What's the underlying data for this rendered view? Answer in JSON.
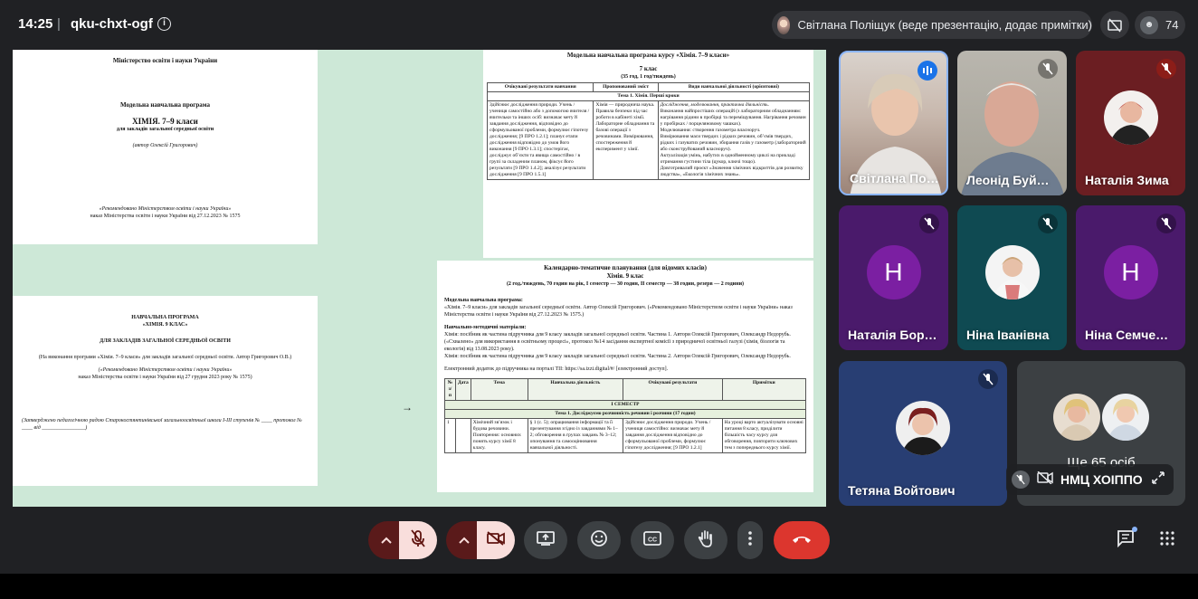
{
  "meeting": {
    "time": "14:25",
    "separator": "|",
    "code": "qku-chxt-ogf",
    "presenter_label": "Світлана Поліщук (веде презентацію, додає примітки)",
    "participants_count": "74"
  },
  "colors": {
    "background": "#202124",
    "accent_red": "#dc362e",
    "avatar_purple": "#7b1fa2",
    "slide_bg": "#cde8d7"
  },
  "presentation": {
    "slide1": {
      "ministry": "Міністерство освіти і науки України",
      "program_type": "Модельна навчальна програма",
      "title": "ХІМІЯ. 7–9 класи",
      "subtitle": "для закладів загальної середньої освіти",
      "author": "(автор Олексій Григорович)",
      "recommended": "«Рекомендовано Міністерством освіти і науки України»",
      "order": "наказ Міністерства освіти і науки України від 27.12.2023 № 1575"
    },
    "slide2": {
      "header": "Модельна навчальна програма курсу «Хімія. 7–9 класи»",
      "grade": "7 клас",
      "hours": "(35 год, 1 год/тиждень)",
      "columns": [
        "Очікувані результати навчання",
        "Пропонований зміст",
        "Види навчальної діяльності (орієнтовні)"
      ],
      "topic": "Тема 1. Хімія. Перші кроки",
      "col1": "Здійснює дослідження природи. Учень / учениця самостійно або з допомогою вчителя / вчительки та інших осіб: визначає мету й завдання дослідження, відповідно до сформульованої проблеми, формулює гіпотезу дослідження; [9 ПРО 1.2.1]; планує етапи дослідження відповідно до умов його виконання [9 ПРО 1.3.1]; спостерігає, досліджує об’єкти та явища самостійно / в групі за складеним планом, фіксує його результати [9 ПРО 1.4.2]; аналізує результати дослідження [9 ПРО 1.5.1]",
      "col2": "Хімія — природнича наука. Правила безпеки під час роботи в кабінеті хімії. Лабораторне обладнання та базові операції з речовинами. Вимірювання, спостереження й експеримент у хімії.",
      "col3_intro": "Дослідження, моделювання, практична діяльність.",
      "col3_items": [
        "Виконання найпростіших операцій (з лабораторним обладнанням: нагрівання рідини в пробірці та переміщування. Нагрівання речовин у пробірках / порцеляновому чашках).",
        "Моделювання: створення газометра власноруч.",
        "Вимірювання маси твердих і рідких речовин, об’ємів твердих, рідких і газуватих речовин, збирання газів у газометр (лабораторний або сконструйований власноруч).",
        "Актуалізація умінь, набутих в однойменному циклі на прикладі отримання густини тіла (цукор, ключі тощо).",
        "Довготривалий проєкт «Значення хімічних відкриттів для розвитку людства», «Екологія хімічних знань»."
      ]
    },
    "slide3": {
      "title": "НАВЧАЛЬНА ПРОГРАМА",
      "course": "«ХІМІЯ. 9 КЛАС»",
      "for": "ДЛЯ ЗАКЛАДІВ ЗАГАЛЬНОЇ СЕРЕДНЬОЇ ОСВІТИ",
      "based": "(На виконання програми «Хімія. 7–9 класи» для закладів загальної середньої освіти. Автор Григорович О.В.)",
      "recommended": "(«Рекомендовано Міністерством освіти і науки України»",
      "order": "наказ Міністерства освіти і науки України від 27 грудня 2023 року № 1575)",
      "approved": "(Затверджено педагогічною радою Старокостянтинівської загальноосвітньої школи І-ІІІ ступенів № ____ протокол № ____ від ________________)"
    },
    "slide4": {
      "header": "Календарно-тематичне планування (для відомих класів)",
      "grade": "Хімія. 9 клас",
      "hours": "(2 год./тиждень, 70 годин на рік, I семестр — 30 годин, II семестр — 38 годин, резерв — 2 години)",
      "model_program_label": "Модельна навчальна програма:",
      "model_program_text": "«Хімія. 7–9 класи» для закладів загальної середньої освіти. Автор Олексій Григорович. («Рекомендовано Міністерством освіти і науки України» наказ Міністерства освіти і науки України від 27.12.2023 № 1575.)",
      "materials_label": "Навчально-методичні матеріали:",
      "materials_1": "Хімія: посібник як частина підручника для 9 класу закладів загальної середньої освіти. Частина 1. Автори Олексій Григорович, Олександр Недорубь. («Схвалено» для використання в освітньому процесі», протокол №14 засідання експертної комісії з природничої освітньої галузі (хімія, біологія та екологія) від 13.08.2023 року).",
      "materials_2": "Хімія: посібник як частина підручника для 9 класу закладів загальної середньої освіти. Частина 2. Автори Олексій Григорович, Олександр Недорубь.",
      "supplement": "Електронний додаток до підручника на порталі ТІІ: https://sa.izzi.digital/#/ [електронний доступ].",
      "columns": [
        "№ з/п",
        "Дата",
        "Тема",
        "Навчальна діяльність",
        "Очікувані результати",
        "Примітки"
      ],
      "semester": "І СЕМЕСТР",
      "topic": "Тема 1. Досліджуємо розчинність речовин і розчини (17 годин)",
      "row": {
        "num": "1",
        "date": "",
        "theme": "Хімічний зв’язок і будова речовини. Повторення: основних понять курсу хімії 8 класу.",
        "activity": "§ 1 (с. 5); опрацювання інформації та її презентування згідно із завданнями № 1–2; обговорення в групах завдань № 3–12; опонування та самооцінювання навчальної діяльності.",
        "results": "Здійснює дослідження природи. Учень / учениця самостійно: визначає мету й завдання дослідження відповідно до сформульованої проблеми, формулює гіпотезу дослідження; [9 ПРО 1.2.1]",
        "notes": "На уроці варто актуалізувати основні питання 8 класу, приділити більшість часу курсу для обговорення, повторити ключових тем з попереднього курсу хімії."
      }
    }
  },
  "participants": [
    {
      "name": "Світлана По…",
      "speaking": true
    },
    {
      "name": "Леонід Буй…",
      "muted": true
    },
    {
      "name": "Наталія Зима",
      "muted": true
    },
    {
      "name": "Наталія Бор…",
      "initial": "Н",
      "muted": true
    },
    {
      "name": "Ніна Іванівна",
      "muted": true
    },
    {
      "name": "Ніна Семче…",
      "initial": "Н",
      "muted": true
    },
    {
      "name": "Тетяна Войтович",
      "muted": true
    }
  ],
  "overflow_tile": {
    "label": "Ще 65 осіб"
  },
  "pinned_bar": {
    "label": "НМЦ ХОІППО"
  },
  "controls": {
    "mic": "microphone-off",
    "camera": "camera-off",
    "present": "present-screen",
    "emoji": "emoji",
    "captions": "CC",
    "hand": "raise-hand",
    "more": "more-options",
    "end": "end-call",
    "chat": "chat",
    "activities": "activities"
  }
}
